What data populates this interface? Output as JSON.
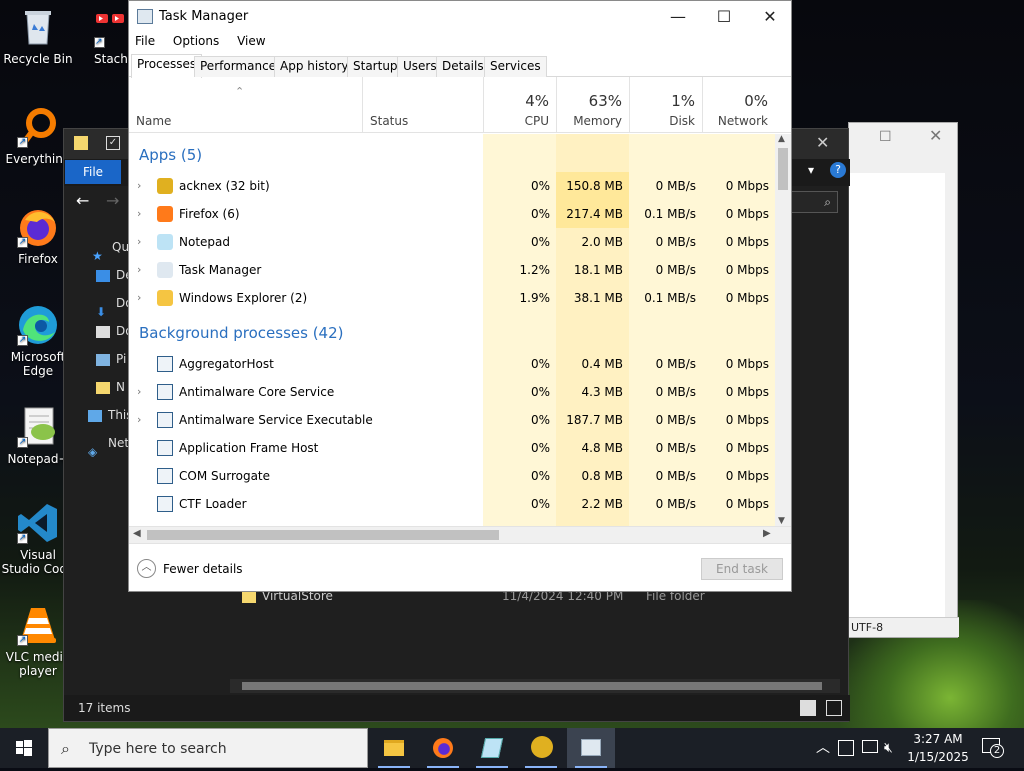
{
  "desktop": {
    "icons": [
      {
        "label": "Recycle Bin"
      },
      {
        "label": "Stache"
      },
      {
        "label": "Everything"
      },
      {
        "label": "Firefox"
      },
      {
        "label": "Microsoft Edge"
      },
      {
        "label": "Notepad+"
      },
      {
        "label": "Visual Studio Code"
      },
      {
        "label": "VLC media player"
      }
    ]
  },
  "explorer": {
    "file_tab": "File",
    "nav": [
      "Qui",
      "De",
      "Do",
      "Do",
      "Pi",
      "N",
      "This",
      "Net"
    ],
    "row_name": "VirtualStore",
    "row_date": "11/4/2024 12:40 PM",
    "row_type": "File folder",
    "status": "17 items"
  },
  "notepad": {
    "encoding": "UTF-8"
  },
  "taskmanager": {
    "title": "Task Manager",
    "menu": [
      "File",
      "Options",
      "View"
    ],
    "tabs": [
      "Processes",
      "Performance",
      "App history",
      "Startup",
      "Users",
      "Details",
      "Services"
    ],
    "columns": {
      "name": "Name",
      "status": "Status",
      "cpu": {
        "pct": "4%",
        "label": "CPU"
      },
      "memory": {
        "pct": "63%",
        "label": "Memory"
      },
      "disk": {
        "pct": "1%",
        "label": "Disk"
      },
      "network": {
        "pct": "0%",
        "label": "Network"
      }
    },
    "apps_header": "Apps (5)",
    "apps": [
      {
        "name": "acknex (32 bit)",
        "cpu": "0%",
        "mem": "150.8 MB",
        "disk": "0 MB/s",
        "net": "0 Mbps"
      },
      {
        "name": "Firefox (6)",
        "cpu": "0%",
        "mem": "217.4 MB",
        "disk": "0.1 MB/s",
        "net": "0 Mbps"
      },
      {
        "name": "Notepad",
        "cpu": "0%",
        "mem": "2.0 MB",
        "disk": "0 MB/s",
        "net": "0 Mbps"
      },
      {
        "name": "Task Manager",
        "cpu": "1.2%",
        "mem": "18.1 MB",
        "disk": "0 MB/s",
        "net": "0 Mbps"
      },
      {
        "name": "Windows Explorer (2)",
        "cpu": "1.9%",
        "mem": "38.1 MB",
        "disk": "0.1 MB/s",
        "net": "0 Mbps"
      }
    ],
    "bg_header": "Background processes (42)",
    "bg": [
      {
        "name": "AggregatorHost",
        "cpu": "0%",
        "mem": "0.4 MB",
        "disk": "0 MB/s",
        "net": "0 Mbps"
      },
      {
        "name": "Antimalware Core Service",
        "cpu": "0%",
        "mem": "4.3 MB",
        "disk": "0 MB/s",
        "net": "0 Mbps"
      },
      {
        "name": "Antimalware Service Executable",
        "cpu": "0%",
        "mem": "187.7 MB",
        "disk": "0 MB/s",
        "net": "0 Mbps"
      },
      {
        "name": "Application Frame Host",
        "cpu": "0%",
        "mem": "4.8 MB",
        "disk": "0 MB/s",
        "net": "0 Mbps"
      },
      {
        "name": "COM Surrogate",
        "cpu": "0%",
        "mem": "0.8 MB",
        "disk": "0 MB/s",
        "net": "0 Mbps"
      },
      {
        "name": "CTF Loader",
        "cpu": "0%",
        "mem": "2.2 MB",
        "disk": "0 MB/s",
        "net": "0 Mbps"
      }
    ],
    "fewer_details": "Fewer details",
    "end_task": "End task"
  },
  "taskbar": {
    "search_placeholder": "Type here to search",
    "time": "3:27 AM",
    "date": "1/15/2025",
    "notifications": "2"
  }
}
